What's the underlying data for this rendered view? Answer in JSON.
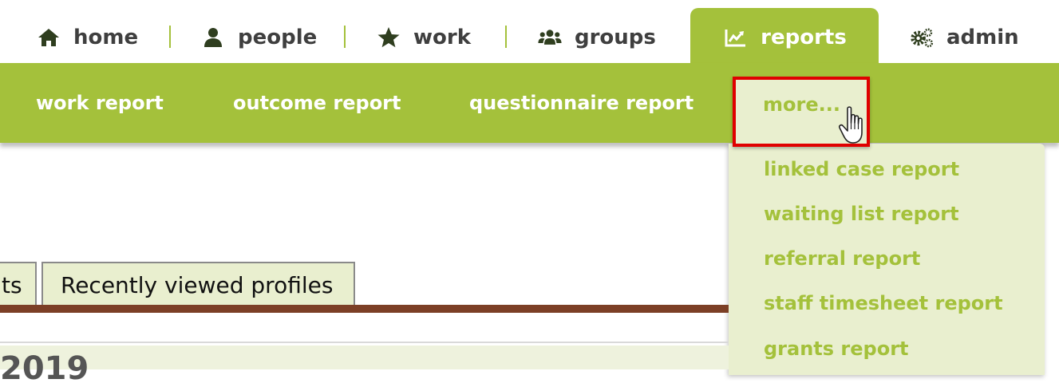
{
  "top_nav": {
    "items": [
      {
        "label": "home",
        "icon": "home-icon"
      },
      {
        "label": "people",
        "icon": "person-icon"
      },
      {
        "label": "work",
        "icon": "star-icon"
      },
      {
        "label": "groups",
        "icon": "users-icon"
      },
      {
        "label": "reports",
        "icon": "chart-line-icon",
        "active": true
      },
      {
        "label": "admin",
        "icon": "gears-icon"
      }
    ]
  },
  "sub_nav": {
    "items": [
      {
        "label": "work report"
      },
      {
        "label": "outcome report"
      },
      {
        "label": "questionnaire report"
      }
    ],
    "more_label": "more..."
  },
  "dropdown": {
    "items": [
      {
        "label": "linked case report"
      },
      {
        "label": "waiting list report"
      },
      {
        "label": "referral report"
      },
      {
        "label": "staff timesheet report"
      },
      {
        "label": "grants report"
      }
    ]
  },
  "tabs": [
    {
      "label": "ts"
    },
    {
      "label": "Recently viewed profiles"
    }
  ],
  "content": {
    "partial_heading": "2019"
  },
  "colors": {
    "accent": "#a4c13b",
    "light_bg": "#e9efcf",
    "highlight": "#e00000",
    "divider": "#7c3f26",
    "nav_text": "#3f3f3f"
  }
}
